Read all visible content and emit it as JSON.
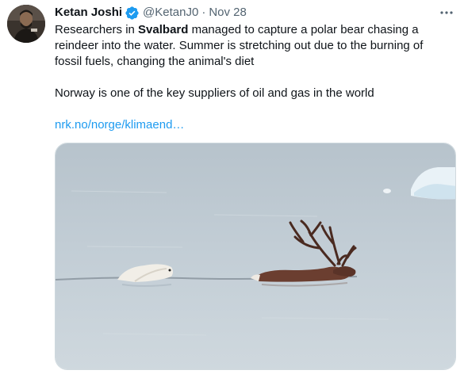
{
  "tweet": {
    "author_name": "Ketan Joshi",
    "handle": "@KetanJ0",
    "separator": "·",
    "date": "Nov 28",
    "text_before_bold": "Researchers in ",
    "text_bold": "Svalbard",
    "text_after_bold": " managed to capture a polar bear chasing a reindeer into the water. Summer is stretching out due to the burning of fossil fuels, changing the animal's diet",
    "paragraph_2": "Norway is one of the key suppliers of oil and gas in the world",
    "link_text": "nrk.no/norge/klimaend…"
  },
  "icons": {
    "verified": "verified-badge-icon",
    "more": "more-dots-icon"
  },
  "colors": {
    "link": "#1d9bf0",
    "secondary_text": "#536471",
    "verified_badge": "#1d9bf0",
    "media_water": "#c2cdd5"
  }
}
